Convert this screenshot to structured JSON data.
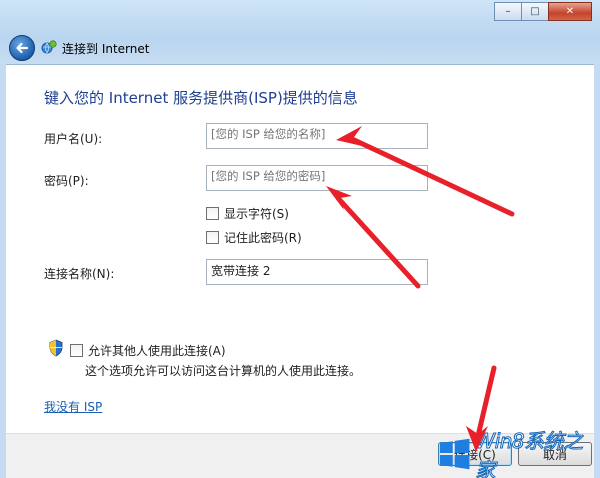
{
  "window": {
    "title": "连接到 Internet",
    "controls": {
      "minimize": "–",
      "maximize": "□",
      "close": "✕"
    }
  },
  "heading": "键入您的 Internet 服务提供商(ISP)提供的信息",
  "fields": {
    "username": {
      "label": "用户名(U):",
      "placeholder": "[您的 ISP 给您的名称]"
    },
    "password": {
      "label": "密码(P):",
      "placeholder": "[您的 ISP 给您的密码]"
    },
    "connection_name": {
      "label": "连接名称(N):",
      "value": "宽带连接 2"
    }
  },
  "checkboxes": {
    "show_chars": "显示字符(S)",
    "remember_password": "记住此密码(R)",
    "allow_others": "允许其他人使用此连接(A)"
  },
  "allow_description": "这个选项允许可以访问这台计算机的人使用此连接。",
  "no_isp_link": "我没有 ISP",
  "buttons": {
    "connect": "连接(C)",
    "cancel": "取消"
  },
  "watermark": {
    "text": "Win8系统之家"
  },
  "colors": {
    "heading": "#1f3f8f",
    "link": "#1a5fb4",
    "annotation_arrow": "#e8202a"
  }
}
